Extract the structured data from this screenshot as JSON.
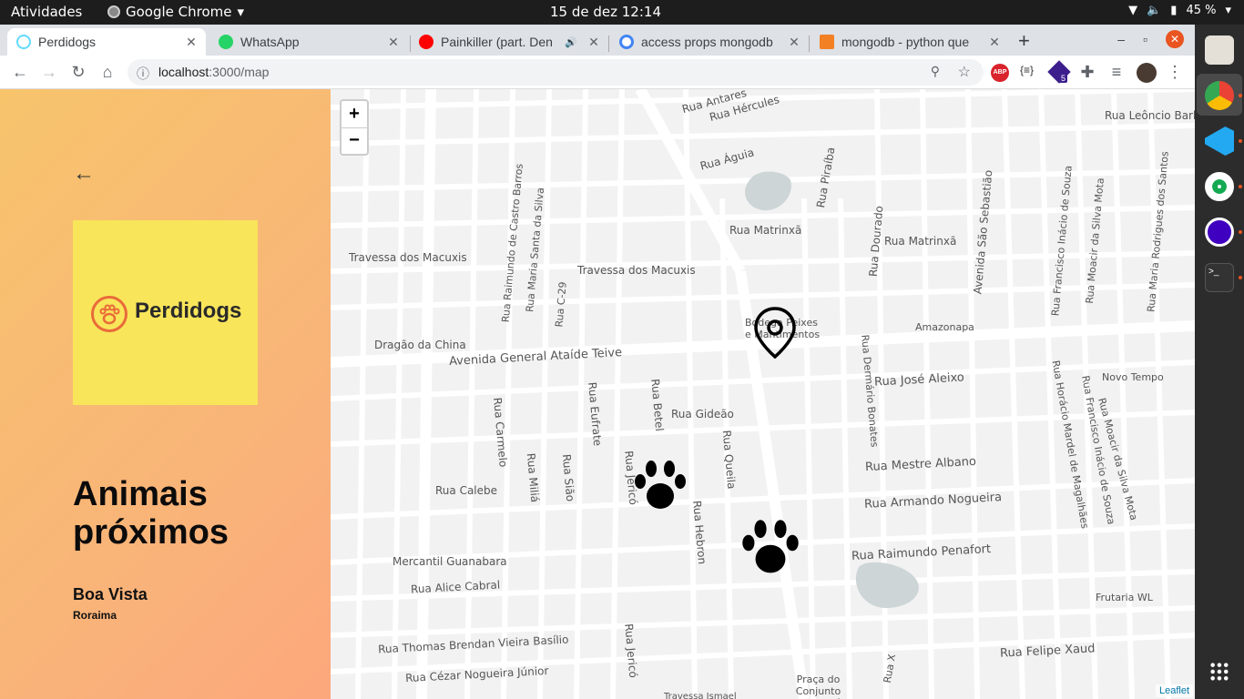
{
  "system": {
    "activities": "Atividades",
    "app_name": "Google Chrome",
    "clock": "15 de dez  12:14",
    "battery": "45 %"
  },
  "browser": {
    "tabs": [
      {
        "title": "Perdidogs",
        "active": true
      },
      {
        "title": "WhatsApp",
        "active": false
      },
      {
        "title": "Painkiller (part. Den",
        "active": false
      },
      {
        "title": "access props mongodb",
        "active": false
      },
      {
        "title": "mongodb - python que",
        "active": false
      }
    ],
    "url_host": "localhost",
    "url_path": ":3000/map",
    "extension_badge": "5"
  },
  "sidebar": {
    "logo_text": "Perdidogs",
    "title": "Animais próximos",
    "city": "Boa Vista",
    "state": "Roraima"
  },
  "map": {
    "zoom_in": "+",
    "zoom_out": "−",
    "attribution": "Leaflet",
    "labels": {
      "l1": "Rua Antares",
      "l2": "Rua Hércules",
      "l3": "Rua Leôncio Barbosa",
      "l4": "Rua Águia",
      "l5": "Rua Piraíba",
      "l6": "Rua Matrinxã",
      "l7": "Rua Dourado",
      "l8": "Rua Matrinxã",
      "l9": "Travessa dos Macuxis",
      "l10": "Travessa dos Macuxis",
      "l11": "Avenida São Sebastião",
      "l12": "Rua Francisco Inácio de Souza",
      "l13": "Rua Moacir da Silva Mota",
      "l14": "Rua Maria Rodrigues dos Santos",
      "l15": "Dragão da China",
      "l16": "Avenida General Ataíde Teive",
      "l17": "Amazonapa",
      "l18": "Bodega Peixes e Mantimentos",
      "l19": "Rua José Aleixo",
      "l20": "Novo Tempo",
      "l21": "Rua Dermário Bonates",
      "l22": "Rua Gideão",
      "l23": "Rua Carmelo",
      "l24": "Rua Eufrate",
      "l25": "Rua Betel",
      "l26": "Rua Mestre Albano",
      "l27": "Rua Calebe",
      "l28": "Rua Miliá",
      "l29": "Rua Sião",
      "l30": "Rua Jericó",
      "l31": "Rua Queila",
      "l32": "Rua Armando Nogueira",
      "l33": "Rua Hebron",
      "l34": "Rua Horácio Mardel de Magalhães",
      "l35": "Rua Francisco Inácio de Souza",
      "l36": "Rua Moacir da Silva Mota",
      "l37": "Mercantil Guanabara",
      "l38": "Rua Raimundo Penafort",
      "l39": "Rua Alice Cabral",
      "l40": "Frutaria WL",
      "l41": "Rua Jericó",
      "l42": "Rua Thomas Brendan Vieira Basílio",
      "l43": "Rua Felipe Xaud",
      "l44": "Rua Cézar Nogueira Júnior",
      "l45": "Praça do Conjunto Cambará",
      "l46": "Rua X",
      "l47": "Rua Raimundo de Castro Barros",
      "l48": "Rua Maria Santa da Silva",
      "l49": "Rua C-29",
      "l50": "Travessa Ismael"
    },
    "markers": [
      {
        "type": "location-pin"
      },
      {
        "type": "paw"
      },
      {
        "type": "paw"
      }
    ]
  },
  "colors": {
    "accent": "#e96a3a",
    "logo_bg": "#f8e55a"
  }
}
